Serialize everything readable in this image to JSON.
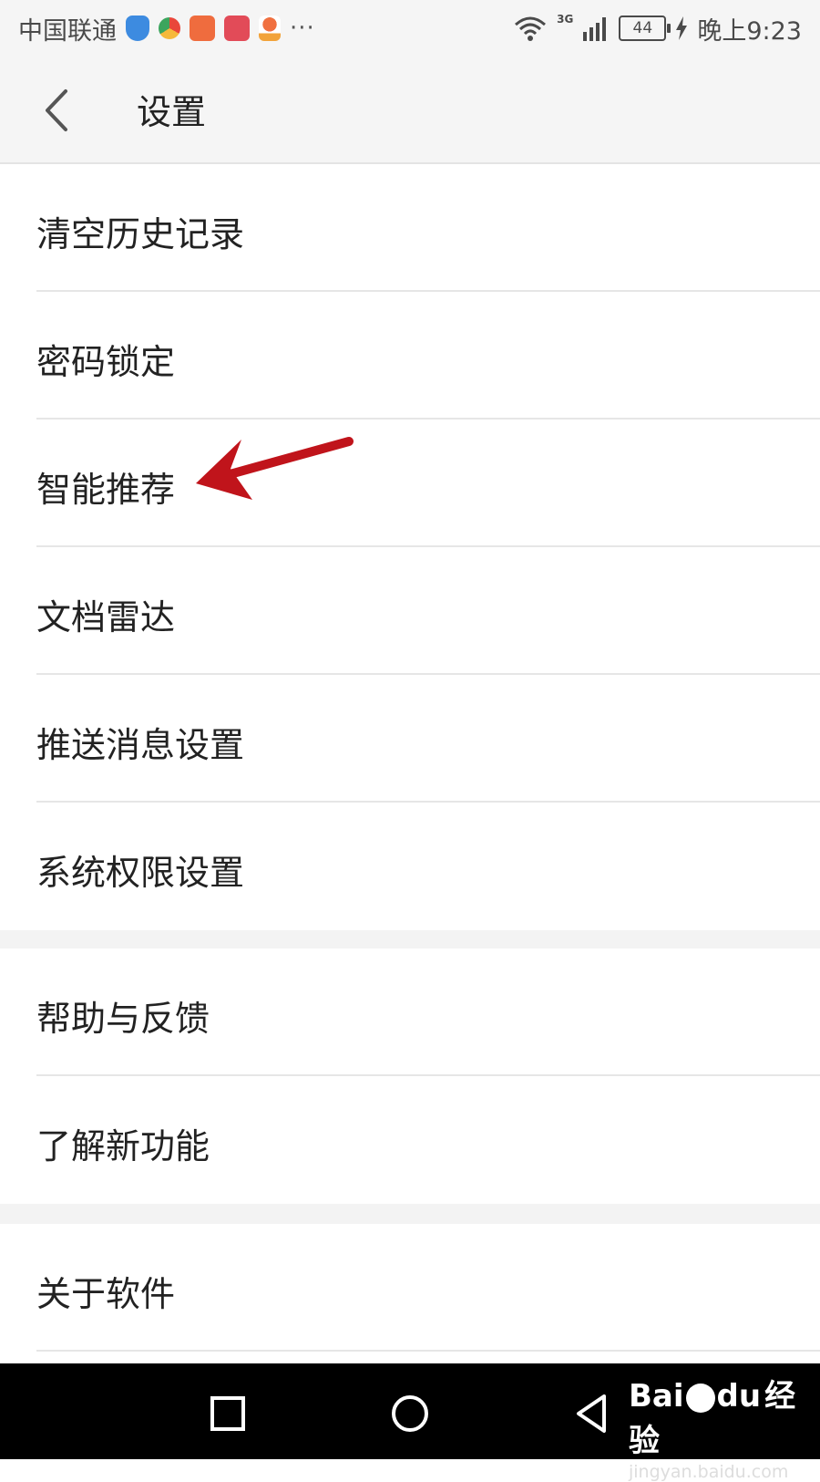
{
  "status_bar": {
    "carrier": "中国联通",
    "network": "3G",
    "battery": "44",
    "time": "晚上9:23",
    "more": "···",
    "icons": [
      "shield-icon",
      "camera-lens-icon",
      "bank-app-icon",
      "heart-app-icon",
      "map-pin-icon",
      "wifi-icon",
      "signal-icon",
      "charging-icon"
    ]
  },
  "header": {
    "title": "设置",
    "back_icon": "chevron-left-icon"
  },
  "settings": {
    "group1": [
      {
        "label": "清空历史记录"
      },
      {
        "label": "密码锁定"
      },
      {
        "label": "智能推荐"
      },
      {
        "label": "文档雷达"
      },
      {
        "label": "推送消息设置"
      },
      {
        "label": "系统权限设置"
      }
    ],
    "group2": [
      {
        "label": "帮助与反馈"
      },
      {
        "label": "了解新功能"
      }
    ],
    "group3": [
      {
        "label": "关于软件"
      }
    ]
  },
  "annotation": {
    "icon": "red-arrow-icon",
    "color": "#c0141b",
    "points_to": "智能推荐"
  },
  "nav_bar": {
    "icons": [
      "recent-apps-icon",
      "home-icon",
      "back-triangle-icon"
    ]
  },
  "watermark": {
    "logo_left": "Bai",
    "logo_right": "du",
    "suffix": "经验",
    "url": "jingyan.baidu.com"
  }
}
